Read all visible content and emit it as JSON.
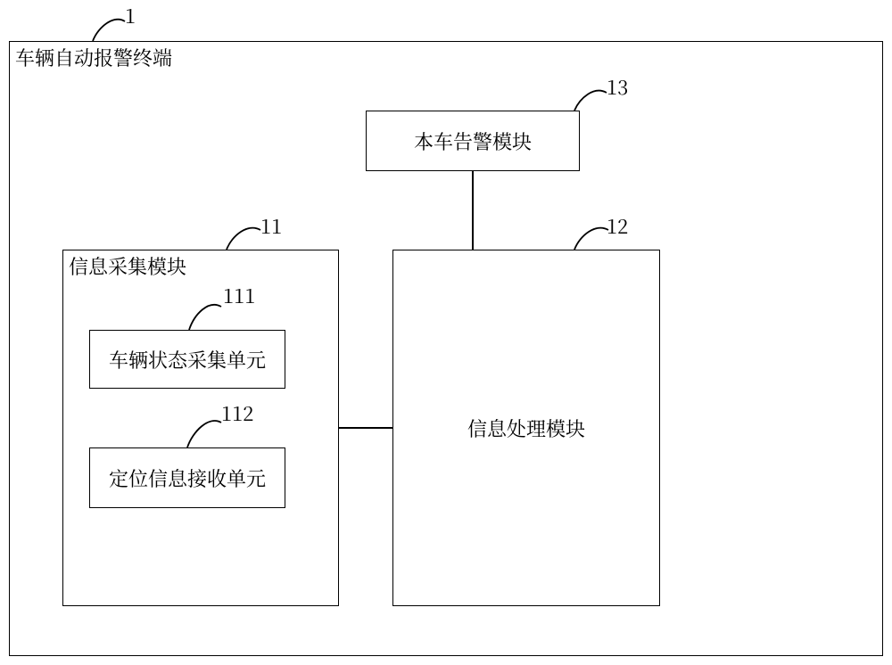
{
  "refs": {
    "outer": "1",
    "collect": "11",
    "proc": "12",
    "alarm": "13",
    "vstate": "111",
    "posrx": "112"
  },
  "labels": {
    "outer": "车辆自动报警终端",
    "collect": "信息采集模块",
    "proc": "信息处理模块",
    "alarm": "本车告警模块",
    "vstate": "车辆状态采集单元",
    "posrx": "定位信息接收单元"
  },
  "chart_data": {
    "type": "block-diagram",
    "blocks": [
      {
        "id": "1",
        "label": "车辆自动报警终端",
        "contains": [
          "11",
          "12",
          "13"
        ]
      },
      {
        "id": "11",
        "label": "信息采集模块",
        "contains": [
          "111",
          "112"
        ]
      },
      {
        "id": "111",
        "label": "车辆状态采集单元"
      },
      {
        "id": "112",
        "label": "定位信息接收单元"
      },
      {
        "id": "12",
        "label": "信息处理模块"
      },
      {
        "id": "13",
        "label": "本车告警模块"
      }
    ],
    "connections": [
      {
        "from": "11",
        "to": "12"
      },
      {
        "from": "13",
        "to": "12"
      }
    ]
  }
}
